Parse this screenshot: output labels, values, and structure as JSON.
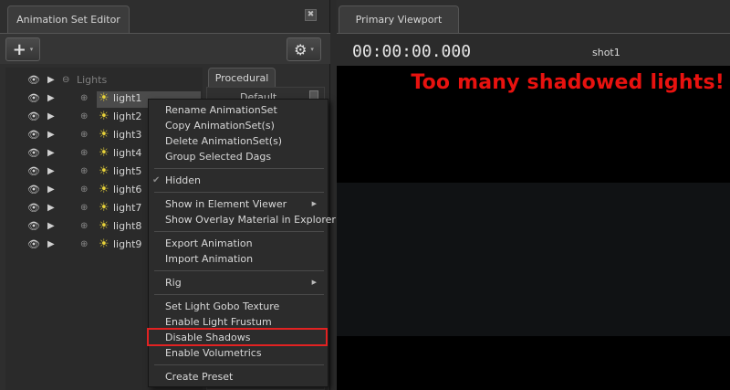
{
  "left_panel": {
    "tab_title": "Animation Set Editor",
    "close_glyph": "✖",
    "add_glyph": "+",
    "gear_glyph": "⚙",
    "caret_glyph": "▾",
    "tree": {
      "group_label": "Lights",
      "items": [
        {
          "label": "light1"
        },
        {
          "label": "light2"
        },
        {
          "label": "light3"
        },
        {
          "label": "light4"
        },
        {
          "label": "light5"
        },
        {
          "label": "light6"
        },
        {
          "label": "light7"
        },
        {
          "label": "light8"
        },
        {
          "label": "light9"
        }
      ]
    },
    "procedural_tab": "Procedural",
    "default_label": "Default"
  },
  "context_menu": {
    "items": [
      {
        "label": "Rename AnimationSet"
      },
      {
        "label": "Copy AnimationSet(s)"
      },
      {
        "label": "Delete AnimationSet(s)"
      },
      {
        "label": "Group Selected Dags"
      },
      {
        "label": "Hidden"
      },
      {
        "label": "Show in Element Viewer"
      },
      {
        "label": "Show Overlay Material in Explorer"
      },
      {
        "label": "Export Animation"
      },
      {
        "label": "Import Animation"
      },
      {
        "label": "Rig"
      },
      {
        "label": "Set Light Gobo Texture"
      },
      {
        "label": "Enable Light Frustum"
      },
      {
        "label": "Disable Shadows"
      },
      {
        "label": "Enable Volumetrics"
      },
      {
        "label": "Create Preset"
      }
    ],
    "highlight_color": "#e22222"
  },
  "right_panel": {
    "tab_title": "Primary Viewport",
    "timecode": "00:00:00.000",
    "shot_name": "shot1",
    "warning": "Too many shadowed lights!",
    "warning_color": "#e8120f"
  }
}
